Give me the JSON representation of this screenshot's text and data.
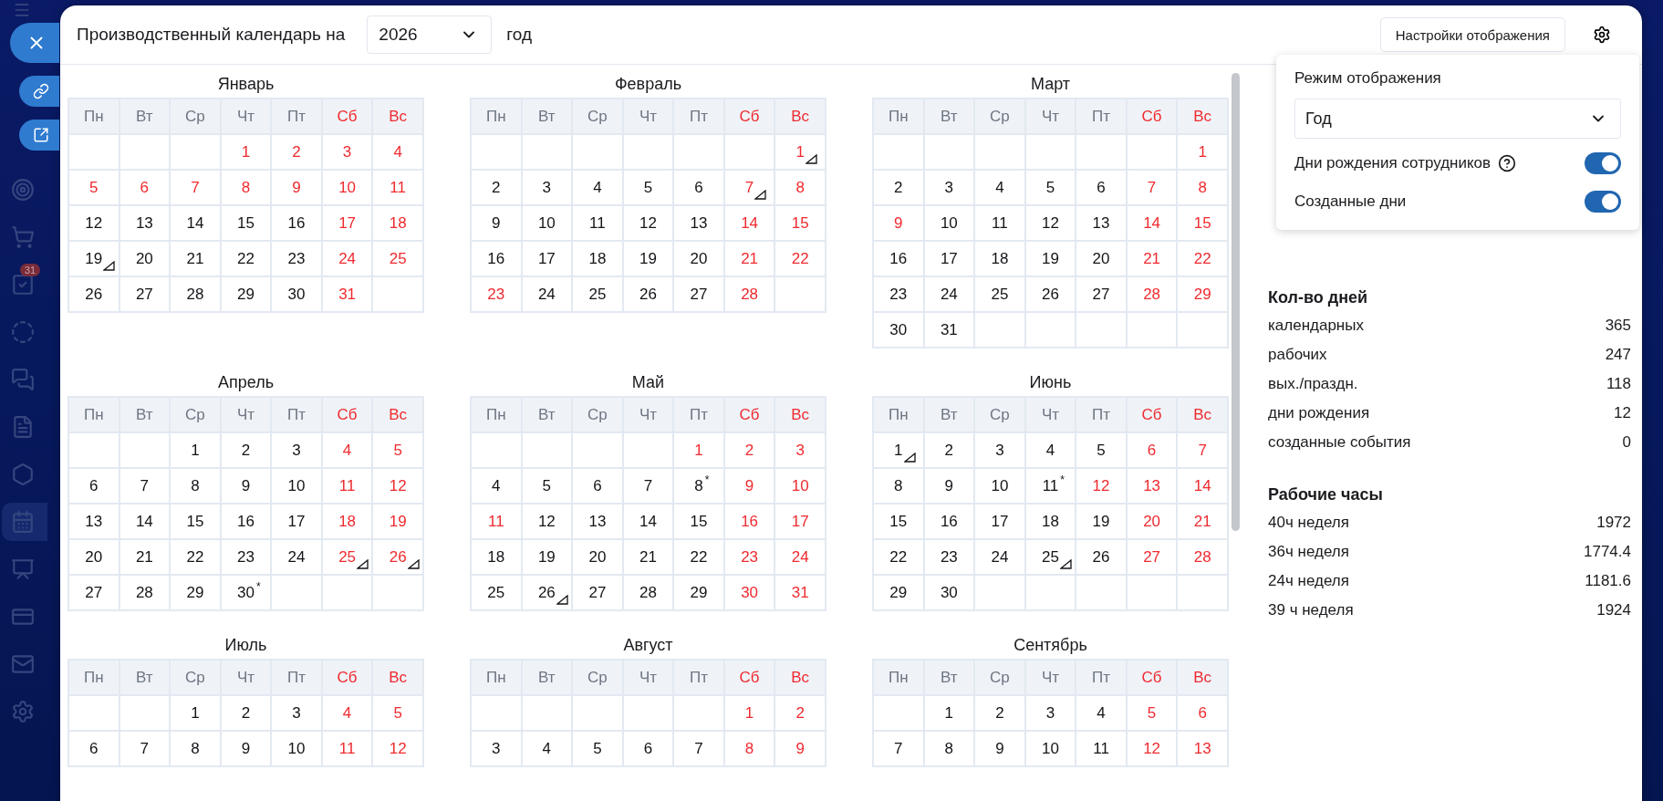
{
  "sidebar": {
    "items": [
      {
        "selected": false
      },
      {
        "selected": false
      },
      {
        "badge": "31",
        "selected": false
      },
      {
        "selected": false
      },
      {
        "selected": false
      },
      {
        "selected": false
      },
      {
        "selected": false
      },
      {
        "selected": true
      },
      {
        "selected": false
      },
      {
        "selected": false
      },
      {
        "selected": false
      },
      {
        "selected": false
      }
    ]
  },
  "floating_buttons": [
    {
      "kind": "close"
    },
    {
      "kind": "link"
    },
    {
      "kind": "open"
    }
  ],
  "header": {
    "title": "Производственный календарь на",
    "year": "2026",
    "suffix": "год",
    "settings_button": "Настройки отображения"
  },
  "months": [
    {
      "name": "Январь",
      "weekdays": [
        {
          "label": "Пн",
          "weekend": false
        },
        {
          "label": "Вт",
          "weekend": false
        },
        {
          "label": "Ср",
          "weekend": false
        },
        {
          "label": "Чт",
          "weekend": false
        },
        {
          "label": "Пт",
          "weekend": false
        },
        {
          "label": "Сб",
          "weekend": true
        },
        {
          "label": "Вс",
          "weekend": true
        }
      ],
      "weeks": [
        [
          {
            "kind": "blank"
          },
          {
            "kind": "blank"
          },
          {
            "kind": "blank"
          },
          {
            "kind": "day",
            "day": "1",
            "holiday": true,
            "birthday": false
          },
          {
            "kind": "day",
            "day": "2",
            "holiday": true,
            "birthday": false
          },
          {
            "kind": "day",
            "day": "3",
            "holiday": true,
            "birthday": false
          },
          {
            "kind": "day",
            "day": "4",
            "holiday": true,
            "birthday": false
          }
        ],
        [
          {
            "kind": "day",
            "day": "5",
            "holiday": true,
            "birthday": false
          },
          {
            "kind": "day",
            "day": "6",
            "holiday": true,
            "birthday": false
          },
          {
            "kind": "day",
            "day": "7",
            "holiday": true,
            "birthday": false
          },
          {
            "kind": "day",
            "day": "8",
            "holiday": true,
            "birthday": false
          },
          {
            "kind": "day",
            "day": "9",
            "holiday": true,
            "birthday": false
          },
          {
            "kind": "day",
            "day": "10",
            "holiday": true,
            "birthday": false
          },
          {
            "kind": "day",
            "day": "11",
            "holiday": true,
            "birthday": false
          }
        ],
        [
          {
            "kind": "day",
            "day": "12",
            "holiday": false,
            "birthday": false
          },
          {
            "kind": "day",
            "day": "13",
            "holiday": false,
            "birthday": false
          },
          {
            "kind": "day",
            "day": "14",
            "holiday": false,
            "birthday": false
          },
          {
            "kind": "day",
            "day": "15",
            "holiday": false,
            "birthday": false
          },
          {
            "kind": "day",
            "day": "16",
            "holiday": false,
            "birthday": false
          },
          {
            "kind": "day",
            "day": "17",
            "holiday": true,
            "birthday": false
          },
          {
            "kind": "day",
            "day": "18",
            "holiday": true,
            "birthday": false
          }
        ],
        [
          {
            "kind": "day",
            "day": "19",
            "holiday": false,
            "birthday": true
          },
          {
            "kind": "day",
            "day": "20",
            "holiday": false,
            "birthday": false
          },
          {
            "kind": "day",
            "day": "21",
            "holiday": false,
            "birthday": false
          },
          {
            "kind": "day",
            "day": "22",
            "holiday": false,
            "birthday": false
          },
          {
            "kind": "day",
            "day": "23",
            "holiday": false,
            "birthday": false
          },
          {
            "kind": "day",
            "day": "24",
            "holiday": true,
            "birthday": false
          },
          {
            "kind": "day",
            "day": "25",
            "holiday": true,
            "birthday": false
          }
        ],
        [
          {
            "kind": "day",
            "day": "26",
            "holiday": false,
            "birthday": false
          },
          {
            "kind": "day",
            "day": "27",
            "holiday": false,
            "birthday": false
          },
          {
            "kind": "day",
            "day": "28",
            "holiday": false,
            "birthday": false
          },
          {
            "kind": "day",
            "day": "29",
            "holiday": false,
            "birthday": false
          },
          {
            "kind": "day",
            "day": "30",
            "holiday": false,
            "birthday": false
          },
          {
            "kind": "day",
            "day": "31",
            "holiday": true,
            "birthday": false
          },
          {
            "kind": "blank"
          }
        ]
      ]
    },
    {
      "name": "Февраль",
      "weekdays": [
        {
          "label": "Пн",
          "weekend": false
        },
        {
          "label": "Вт",
          "weekend": false
        },
        {
          "label": "Ср",
          "weekend": false
        },
        {
          "label": "Чт",
          "weekend": false
        },
        {
          "label": "Пт",
          "weekend": false
        },
        {
          "label": "Сб",
          "weekend": true
        },
        {
          "label": "Вс",
          "weekend": true
        }
      ],
      "weeks": [
        [
          {
            "kind": "blank"
          },
          {
            "kind": "blank"
          },
          {
            "kind": "blank"
          },
          {
            "kind": "blank"
          },
          {
            "kind": "blank"
          },
          {
            "kind": "blank"
          },
          {
            "kind": "day",
            "day": "1",
            "holiday": true,
            "birthday": true
          }
        ],
        [
          {
            "kind": "day",
            "day": "2",
            "holiday": false,
            "birthday": false
          },
          {
            "kind": "day",
            "day": "3",
            "holiday": false,
            "birthday": false
          },
          {
            "kind": "day",
            "day": "4",
            "holiday": false,
            "birthday": false
          },
          {
            "kind": "day",
            "day": "5",
            "holiday": false,
            "birthday": false
          },
          {
            "kind": "day",
            "day": "6",
            "holiday": false,
            "birthday": false
          },
          {
            "kind": "day",
            "day": "7",
            "holiday": true,
            "birthday": true
          },
          {
            "kind": "day",
            "day": "8",
            "holiday": true,
            "birthday": false
          }
        ],
        [
          {
            "kind": "day",
            "day": "9",
            "holiday": false,
            "birthday": false
          },
          {
            "kind": "day",
            "day": "10",
            "holiday": false,
            "birthday": false
          },
          {
            "kind": "day",
            "day": "11",
            "holiday": false,
            "birthday": false
          },
          {
            "kind": "day",
            "day": "12",
            "holiday": false,
            "birthday": false
          },
          {
            "kind": "day",
            "day": "13",
            "holiday": false,
            "birthday": false
          },
          {
            "kind": "day",
            "day": "14",
            "holiday": true,
            "birthday": false
          },
          {
            "kind": "day",
            "day": "15",
            "holiday": true,
            "birthday": false
          }
        ],
        [
          {
            "kind": "day",
            "day": "16",
            "holiday": false,
            "birthday": false
          },
          {
            "kind": "day",
            "day": "17",
            "holiday": false,
            "birthday": false
          },
          {
            "kind": "day",
            "day": "18",
            "holiday": false,
            "birthday": false
          },
          {
            "kind": "day",
            "day": "19",
            "holiday": false,
            "birthday": false
          },
          {
            "kind": "day",
            "day": "20",
            "holiday": false,
            "birthday": false
          },
          {
            "kind": "day",
            "day": "21",
            "holiday": true,
            "birthday": false
          },
          {
            "kind": "day",
            "day": "22",
            "holiday": true,
            "birthday": false
          }
        ],
        [
          {
            "kind": "day",
            "day": "23",
            "holiday": true,
            "birthday": false
          },
          {
            "kind": "day",
            "day": "24",
            "holiday": false,
            "birthday": false
          },
          {
            "kind": "day",
            "day": "25",
            "holiday": false,
            "birthday": false
          },
          {
            "kind": "day",
            "day": "26",
            "holiday": false,
            "birthday": false
          },
          {
            "kind": "day",
            "day": "27",
            "holiday": false,
            "birthday": false
          },
          {
            "kind": "day",
            "day": "28",
            "holiday": true,
            "birthday": false
          },
          {
            "kind": "blank"
          }
        ]
      ]
    },
    {
      "name": "Март",
      "weekdays": [
        {
          "label": "Пн",
          "weekend": false
        },
        {
          "label": "Вт",
          "weekend": false
        },
        {
          "label": "Ср",
          "weekend": false
        },
        {
          "label": "Чт",
          "weekend": false
        },
        {
          "label": "Пт",
          "weekend": false
        },
        {
          "label": "Сб",
          "weekend": true
        },
        {
          "label": "Вс",
          "weekend": true
        }
      ],
      "weeks": [
        [
          {
            "kind": "blank"
          },
          {
            "kind": "blank"
          },
          {
            "kind": "blank"
          },
          {
            "kind": "blank"
          },
          {
            "kind": "blank"
          },
          {
            "kind": "blank"
          },
          {
            "kind": "day",
            "day": "1",
            "holiday": true,
            "birthday": false
          }
        ],
        [
          {
            "kind": "day",
            "day": "2",
            "holiday": false,
            "birthday": false
          },
          {
            "kind": "day",
            "day": "3",
            "holiday": false,
            "birthday": false
          },
          {
            "kind": "day",
            "day": "4",
            "holiday": false,
            "birthday": false
          },
          {
            "kind": "day",
            "day": "5",
            "holiday": false,
            "birthday": false
          },
          {
            "kind": "day",
            "day": "6",
            "holiday": false,
            "birthday": false
          },
          {
            "kind": "day",
            "day": "7",
            "holiday": true,
            "birthday": false
          },
          {
            "kind": "day",
            "day": "8",
            "holiday": true,
            "birthday": false
          }
        ],
        [
          {
            "kind": "day",
            "day": "9",
            "holiday": true,
            "birthday": false
          },
          {
            "kind": "day",
            "day": "10",
            "holiday": false,
            "birthday": false
          },
          {
            "kind": "day",
            "day": "11",
            "holiday": false,
            "birthday": false
          },
          {
            "kind": "day",
            "day": "12",
            "holiday": false,
            "birthday": false
          },
          {
            "kind": "day",
            "day": "13",
            "holiday": false,
            "birthday": false
          },
          {
            "kind": "day",
            "day": "14",
            "holiday": true,
            "birthday": false
          },
          {
            "kind": "day",
            "day": "15",
            "holiday": true,
            "birthday": false
          }
        ],
        [
          {
            "kind": "day",
            "day": "16",
            "holiday": false,
            "birthday": false
          },
          {
            "kind": "day",
            "day": "17",
            "holiday": false,
            "birthday": false
          },
          {
            "kind": "day",
            "day": "18",
            "holiday": false,
            "birthday": false
          },
          {
            "kind": "day",
            "day": "19",
            "holiday": false,
            "birthday": false
          },
          {
            "kind": "day",
            "day": "20",
            "holiday": false,
            "birthday": false
          },
          {
            "kind": "day",
            "day": "21",
            "holiday": true,
            "birthday": false
          },
          {
            "kind": "day",
            "day": "22",
            "holiday": true,
            "birthday": false
          }
        ],
        [
          {
            "kind": "day",
            "day": "23",
            "holiday": false,
            "birthday": false
          },
          {
            "kind": "day",
            "day": "24",
            "holiday": false,
            "birthday": false
          },
          {
            "kind": "day",
            "day": "25",
            "holiday": false,
            "birthday": false
          },
          {
            "kind": "day",
            "day": "26",
            "holiday": false,
            "birthday": false
          },
          {
            "kind": "day",
            "day": "27",
            "holiday": false,
            "birthday": false
          },
          {
            "kind": "day",
            "day": "28",
            "holiday": true,
            "birthday": false
          },
          {
            "kind": "day",
            "day": "29",
            "holiday": true,
            "birthday": false
          }
        ],
        [
          {
            "kind": "day",
            "day": "30",
            "holiday": false,
            "birthday": false
          },
          {
            "kind": "day",
            "day": "31",
            "holiday": false,
            "birthday": false
          },
          {
            "kind": "blank"
          },
          {
            "kind": "blank"
          },
          {
            "kind": "blank"
          },
          {
            "kind": "blank"
          },
          {
            "kind": "blank"
          }
        ]
      ]
    },
    {
      "name": "Апрель",
      "weekdays": [
        {
          "label": "Пн",
          "weekend": false
        },
        {
          "label": "Вт",
          "weekend": false
        },
        {
          "label": "Ср",
          "weekend": false
        },
        {
          "label": "Чт",
          "weekend": false
        },
        {
          "label": "Пт",
          "weekend": false
        },
        {
          "label": "Сб",
          "weekend": true
        },
        {
          "label": "Вс",
          "weekend": true
        }
      ],
      "weeks": [
        [
          {
            "kind": "blank"
          },
          {
            "kind": "blank"
          },
          {
            "kind": "day",
            "day": "1",
            "holiday": false,
            "birthday": false
          },
          {
            "kind": "day",
            "day": "2",
            "holiday": false,
            "birthday": false
          },
          {
            "kind": "day",
            "day": "3",
            "holiday": false,
            "birthday": false
          },
          {
            "kind": "day",
            "day": "4",
            "holiday": true,
            "birthday": false
          },
          {
            "kind": "day",
            "day": "5",
            "holiday": true,
            "birthday": false
          }
        ],
        [
          {
            "kind": "day",
            "day": "6",
            "holiday": false,
            "birthday": false
          },
          {
            "kind": "day",
            "day": "7",
            "holiday": false,
            "birthday": false
          },
          {
            "kind": "day",
            "day": "8",
            "holiday": false,
            "birthday": false
          },
          {
            "kind": "day",
            "day": "9",
            "holiday": false,
            "birthday": false
          },
          {
            "kind": "day",
            "day": "10",
            "holiday": false,
            "birthday": false
          },
          {
            "kind": "day",
            "day": "11",
            "holiday": true,
            "birthday": false
          },
          {
            "kind": "day",
            "day": "12",
            "holiday": true,
            "birthday": false
          }
        ],
        [
          {
            "kind": "day",
            "day": "13",
            "holiday": false,
            "birthday": false
          },
          {
            "kind": "day",
            "day": "14",
            "holiday": false,
            "birthday": false
          },
          {
            "kind": "day",
            "day": "15",
            "holiday": false,
            "birthday": false
          },
          {
            "kind": "day",
            "day": "16",
            "holiday": false,
            "birthday": false
          },
          {
            "kind": "day",
            "day": "17",
            "holiday": false,
            "birthday": false
          },
          {
            "kind": "day",
            "day": "18",
            "holiday": true,
            "birthday": false
          },
          {
            "kind": "day",
            "day": "19",
            "holiday": true,
            "birthday": false
          }
        ],
        [
          {
            "kind": "day",
            "day": "20",
            "holiday": false,
            "birthday": false
          },
          {
            "kind": "day",
            "day": "21",
            "holiday": false,
            "birthday": false
          },
          {
            "kind": "day",
            "day": "22",
            "holiday": false,
            "birthday": false
          },
          {
            "kind": "day",
            "day": "23",
            "holiday": false,
            "birthday": false
          },
          {
            "kind": "day",
            "day": "24",
            "holiday": false,
            "birthday": false
          },
          {
            "kind": "day",
            "day": "25",
            "holiday": true,
            "birthday": true
          },
          {
            "kind": "day",
            "day": "26",
            "holiday": true,
            "birthday": true
          }
        ],
        [
          {
            "kind": "day",
            "day": "27",
            "holiday": false,
            "birthday": false
          },
          {
            "kind": "day",
            "day": "28",
            "holiday": false,
            "birthday": false
          },
          {
            "kind": "day",
            "day": "29",
            "holiday": false,
            "birthday": false
          },
          {
            "kind": "day",
            "day": "30",
            "note": "*",
            "holiday": false,
            "birthday": false
          },
          {
            "kind": "blank"
          },
          {
            "kind": "blank"
          },
          {
            "kind": "blank"
          }
        ]
      ]
    },
    {
      "name": "Май",
      "weekdays": [
        {
          "label": "Пн",
          "weekend": false
        },
        {
          "label": "Вт",
          "weekend": false
        },
        {
          "label": "Ср",
          "weekend": false
        },
        {
          "label": "Чт",
          "weekend": false
        },
        {
          "label": "Пт",
          "weekend": false
        },
        {
          "label": "Сб",
          "weekend": true
        },
        {
          "label": "Вс",
          "weekend": true
        }
      ],
      "weeks": [
        [
          {
            "kind": "blank"
          },
          {
            "kind": "blank"
          },
          {
            "kind": "blank"
          },
          {
            "kind": "blank"
          },
          {
            "kind": "day",
            "day": "1",
            "holiday": true,
            "birthday": false
          },
          {
            "kind": "day",
            "day": "2",
            "holiday": true,
            "birthday": false
          },
          {
            "kind": "day",
            "day": "3",
            "holiday": true,
            "birthday": false
          }
        ],
        [
          {
            "kind": "day",
            "day": "4",
            "holiday": false,
            "birthday": false
          },
          {
            "kind": "day",
            "day": "5",
            "holiday": false,
            "birthday": false
          },
          {
            "kind": "day",
            "day": "6",
            "holiday": false,
            "birthday": false
          },
          {
            "kind": "day",
            "day": "7",
            "holiday": false,
            "birthday": false
          },
          {
            "kind": "day",
            "day": "8",
            "note": "*",
            "holiday": false,
            "birthday": false
          },
          {
            "kind": "day",
            "day": "9",
            "holiday": true,
            "birthday": false
          },
          {
            "kind": "day",
            "day": "10",
            "holiday": true,
            "birthday": false
          }
        ],
        [
          {
            "kind": "day",
            "day": "11",
            "holiday": true,
            "birthday": false
          },
          {
            "kind": "day",
            "day": "12",
            "holiday": false,
            "birthday": false
          },
          {
            "kind": "day",
            "day": "13",
            "holiday": false,
            "birthday": false
          },
          {
            "kind": "day",
            "day": "14",
            "holiday": false,
            "birthday": false
          },
          {
            "kind": "day",
            "day": "15",
            "holiday": false,
            "birthday": false
          },
          {
            "kind": "day",
            "day": "16",
            "holiday": true,
            "birthday": false
          },
          {
            "kind": "day",
            "day": "17",
            "holiday": true,
            "birthday": false
          }
        ],
        [
          {
            "kind": "day",
            "day": "18",
            "holiday": false,
            "birthday": false
          },
          {
            "kind": "day",
            "day": "19",
            "holiday": false,
            "birthday": false
          },
          {
            "kind": "day",
            "day": "20",
            "holiday": false,
            "birthday": false
          },
          {
            "kind": "day",
            "day": "21",
            "holiday": false,
            "birthday": false
          },
          {
            "kind": "day",
            "day": "22",
            "holiday": false,
            "birthday": false
          },
          {
            "kind": "day",
            "day": "23",
            "holiday": true,
            "birthday": false
          },
          {
            "kind": "day",
            "day": "24",
            "holiday": true,
            "birthday": false
          }
        ],
        [
          {
            "kind": "day",
            "day": "25",
            "holiday": false,
            "birthday": false
          },
          {
            "kind": "day",
            "day": "26",
            "holiday": false,
            "birthday": true
          },
          {
            "kind": "day",
            "day": "27",
            "holiday": false,
            "birthday": false
          },
          {
            "kind": "day",
            "day": "28",
            "holiday": false,
            "birthday": false
          },
          {
            "kind": "day",
            "day": "29",
            "holiday": false,
            "birthday": false
          },
          {
            "kind": "day",
            "day": "30",
            "holiday": true,
            "birthday": false
          },
          {
            "kind": "day",
            "day": "31",
            "holiday": true,
            "birthday": false
          }
        ]
      ]
    },
    {
      "name": "Июнь",
      "weekdays": [
        {
          "label": "Пн",
          "weekend": false
        },
        {
          "label": "Вт",
          "weekend": false
        },
        {
          "label": "Ср",
          "weekend": false
        },
        {
          "label": "Чт",
          "weekend": false
        },
        {
          "label": "Пт",
          "weekend": false
        },
        {
          "label": "Сб",
          "weekend": true
        },
        {
          "label": "Вс",
          "weekend": true
        }
      ],
      "weeks": [
        [
          {
            "kind": "day",
            "day": "1",
            "holiday": false,
            "birthday": true
          },
          {
            "kind": "day",
            "day": "2",
            "holiday": false,
            "birthday": false
          },
          {
            "kind": "day",
            "day": "3",
            "holiday": false,
            "birthday": false
          },
          {
            "kind": "day",
            "day": "4",
            "holiday": false,
            "birthday": false
          },
          {
            "kind": "day",
            "day": "5",
            "holiday": false,
            "birthday": false
          },
          {
            "kind": "day",
            "day": "6",
            "holiday": true,
            "birthday": false
          },
          {
            "kind": "day",
            "day": "7",
            "holiday": true,
            "birthday": false
          }
        ],
        [
          {
            "kind": "day",
            "day": "8",
            "holiday": false,
            "birthday": false
          },
          {
            "kind": "day",
            "day": "9",
            "holiday": false,
            "birthday": false
          },
          {
            "kind": "day",
            "day": "10",
            "holiday": false,
            "birthday": false
          },
          {
            "kind": "day",
            "day": "11",
            "note": "*",
            "holiday": false,
            "birthday": false
          },
          {
            "kind": "day",
            "day": "12",
            "holiday": true,
            "birthday": false
          },
          {
            "kind": "day",
            "day": "13",
            "holiday": true,
            "birthday": false
          },
          {
            "kind": "day",
            "day": "14",
            "holiday": true,
            "birthday": false
          }
        ],
        [
          {
            "kind": "day",
            "day": "15",
            "holiday": false,
            "birthday": false
          },
          {
            "kind": "day",
            "day": "16",
            "holiday": false,
            "birthday": false
          },
          {
            "kind": "day",
            "day": "17",
            "holiday": false,
            "birthday": false
          },
          {
            "kind": "day",
            "day": "18",
            "holiday": false,
            "birthday": false
          },
          {
            "kind": "day",
            "day": "19",
            "holiday": false,
            "birthday": false
          },
          {
            "kind": "day",
            "day": "20",
            "holiday": true,
            "birthday": false
          },
          {
            "kind": "day",
            "day": "21",
            "holiday": true,
            "birthday": false
          }
        ],
        [
          {
            "kind": "day",
            "day": "22",
            "holiday": false,
            "birthday": false
          },
          {
            "kind": "day",
            "day": "23",
            "holiday": false,
            "birthday": false
          },
          {
            "kind": "day",
            "day": "24",
            "holiday": false,
            "birthday": false
          },
          {
            "kind": "day",
            "day": "25",
            "holiday": false,
            "birthday": true
          },
          {
            "kind": "day",
            "day": "26",
            "holiday": false,
            "birthday": false
          },
          {
            "kind": "day",
            "day": "27",
            "holiday": true,
            "birthday": false
          },
          {
            "kind": "day",
            "day": "28",
            "holiday": true,
            "birthday": false
          }
        ],
        [
          {
            "kind": "day",
            "day": "29",
            "holiday": false,
            "birthday": false
          },
          {
            "kind": "day",
            "day": "30",
            "holiday": false,
            "birthday": false
          },
          {
            "kind": "blank"
          },
          {
            "kind": "blank"
          },
          {
            "kind": "blank"
          },
          {
            "kind": "blank"
          },
          {
            "kind": "blank"
          }
        ]
      ]
    },
    {
      "name": "Июль",
      "weekdays": [
        {
          "label": "Пн",
          "weekend": false
        },
        {
          "label": "Вт",
          "weekend": false
        },
        {
          "label": "Ср",
          "weekend": false
        },
        {
          "label": "Чт",
          "weekend": false
        },
        {
          "label": "Пт",
          "weekend": false
        },
        {
          "label": "Сб",
          "weekend": true
        },
        {
          "label": "Вс",
          "weekend": true
        }
      ],
      "weeks": [
        [
          {
            "kind": "blank"
          },
          {
            "kind": "blank"
          },
          {
            "kind": "day",
            "day": "1",
            "holiday": false,
            "birthday": false
          },
          {
            "kind": "day",
            "day": "2",
            "holiday": false,
            "birthday": false
          },
          {
            "kind": "day",
            "day": "3",
            "holiday": false,
            "birthday": false
          },
          {
            "kind": "day",
            "day": "4",
            "holiday": true,
            "birthday": false
          },
          {
            "kind": "day",
            "day": "5",
            "holiday": true,
            "birthday": false
          }
        ],
        [
          {
            "kind": "day",
            "day": "6",
            "holiday": false,
            "birthday": false
          },
          {
            "kind": "day",
            "day": "7",
            "holiday": false,
            "birthday": false
          },
          {
            "kind": "day",
            "day": "8",
            "holiday": false,
            "birthday": false
          },
          {
            "kind": "day",
            "day": "9",
            "holiday": false,
            "birthday": false
          },
          {
            "kind": "day",
            "day": "10",
            "holiday": false,
            "birthday": false
          },
          {
            "kind": "day",
            "day": "11",
            "holiday": true,
            "birthday": false
          },
          {
            "kind": "day",
            "day": "12",
            "holiday": true,
            "birthday": false
          }
        ]
      ]
    },
    {
      "name": "Август",
      "weekdays": [
        {
          "label": "Пн",
          "weekend": false
        },
        {
          "label": "Вт",
          "weekend": false
        },
        {
          "label": "Ср",
          "weekend": false
        },
        {
          "label": "Чт",
          "weekend": false
        },
        {
          "label": "Пт",
          "weekend": false
        },
        {
          "label": "Сб",
          "weekend": true
        },
        {
          "label": "Вс",
          "weekend": true
        }
      ],
      "weeks": [
        [
          {
            "kind": "blank"
          },
          {
            "kind": "blank"
          },
          {
            "kind": "blank"
          },
          {
            "kind": "blank"
          },
          {
            "kind": "blank"
          },
          {
            "kind": "day",
            "day": "1",
            "holiday": true,
            "birthday": false
          },
          {
            "kind": "day",
            "day": "2",
            "holiday": true,
            "birthday": false
          }
        ],
        [
          {
            "kind": "day",
            "day": "3",
            "holiday": false,
            "birthday": false
          },
          {
            "kind": "day",
            "day": "4",
            "holiday": false,
            "birthday": false
          },
          {
            "kind": "day",
            "day": "5",
            "holiday": false,
            "birthday": false
          },
          {
            "kind": "day",
            "day": "6",
            "holiday": false,
            "birthday": false
          },
          {
            "kind": "day",
            "day": "7",
            "holiday": false,
            "birthday": false
          },
          {
            "kind": "day",
            "day": "8",
            "holiday": true,
            "birthday": false
          },
          {
            "kind": "day",
            "day": "9",
            "holiday": true,
            "birthday": false
          }
        ]
      ]
    },
    {
      "name": "Сентябрь",
      "weekdays": [
        {
          "label": "Пн",
          "weekend": false
        },
        {
          "label": "Вт",
          "weekend": false
        },
        {
          "label": "Ср",
          "weekend": false
        },
        {
          "label": "Чт",
          "weekend": false
        },
        {
          "label": "Пт",
          "weekend": false
        },
        {
          "label": "Сб",
          "weekend": true
        },
        {
          "label": "Вс",
          "weekend": true
        }
      ],
      "weeks": [
        [
          {
            "kind": "blank"
          },
          {
            "kind": "day",
            "day": "1",
            "holiday": false,
            "birthday": false
          },
          {
            "kind": "day",
            "day": "2",
            "holiday": false,
            "birthday": false
          },
          {
            "kind": "day",
            "day": "3",
            "holiday": false,
            "birthday": false
          },
          {
            "kind": "day",
            "day": "4",
            "holiday": false,
            "birthday": false
          },
          {
            "kind": "day",
            "day": "5",
            "holiday": true,
            "birthday": false
          },
          {
            "kind": "day",
            "day": "6",
            "holiday": true,
            "birthday": false
          }
        ],
        [
          {
            "kind": "day",
            "day": "7",
            "holiday": false,
            "birthday": false
          },
          {
            "kind": "day",
            "day": "8",
            "holiday": false,
            "birthday": false
          },
          {
            "kind": "day",
            "day": "9",
            "holiday": false,
            "birthday": false
          },
          {
            "kind": "day",
            "day": "10",
            "holiday": false,
            "birthday": false
          },
          {
            "kind": "day",
            "day": "11",
            "holiday": false,
            "birthday": false
          },
          {
            "kind": "day",
            "day": "12",
            "holiday": true,
            "birthday": false
          },
          {
            "kind": "day",
            "day": "13",
            "holiday": true,
            "birthday": false
          }
        ]
      ]
    }
  ],
  "display_settings": {
    "title": "Режим отображения",
    "mode": "Год",
    "toggles": [
      {
        "label": "Дни рождения сотрудников",
        "help": true,
        "on": true
      },
      {
        "label": "Созданные дни",
        "help": false,
        "on": true
      }
    ]
  },
  "stats": [
    {
      "title": "Кол-во дней",
      "rows": [
        {
          "label": "календарных",
          "value": "365"
        },
        {
          "label": "рабочих",
          "value": "247"
        },
        {
          "label": "вых./праздн.",
          "value": "118"
        },
        {
          "label": "дни рождения",
          "value": "12"
        },
        {
          "label": "созданные события",
          "value": "0"
        }
      ]
    },
    {
      "title": "Рабочие часы",
      "rows": [
        {
          "label": "40ч неделя",
          "value": "1972"
        },
        {
          "label": "36ч неделя",
          "value": "1774.4"
        },
        {
          "label": "24ч неделя",
          "value": "1181.6"
        },
        {
          "label": "39 ч неделя",
          "value": "1924"
        }
      ]
    }
  ]
}
